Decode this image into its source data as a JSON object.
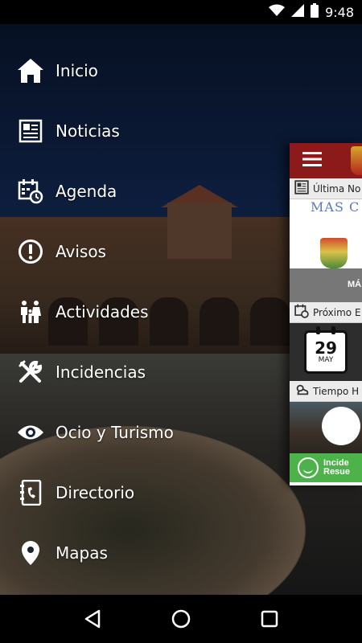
{
  "status_bar": {
    "time": "9:48",
    "icons": [
      "wifi-icon",
      "signal-icon",
      "battery-icon"
    ]
  },
  "menu": {
    "items": [
      {
        "label": "Inicio",
        "icon": "home-icon"
      },
      {
        "label": "Noticias",
        "icon": "newspaper-icon"
      },
      {
        "label": "Agenda",
        "icon": "calendar-clock-icon"
      },
      {
        "label": "Avisos",
        "icon": "alert-circle-icon"
      },
      {
        "label": "Actividades",
        "icon": "family-icon"
      },
      {
        "label": "Incidencias",
        "icon": "tools-icon"
      },
      {
        "label": "Ocio y Turismo",
        "icon": "eye-icon"
      },
      {
        "label": "Directorio",
        "icon": "contact-book-icon"
      },
      {
        "label": "Mapas",
        "icon": "map-pin-icon"
      }
    ]
  },
  "preview": {
    "news_header": "Última No",
    "news_masthead": "MAS C",
    "news_caption": "MÁ",
    "event_header": "Próximo E",
    "event_day": "29",
    "event_month": "MAY",
    "weather_header": "Tiempo H",
    "incident_line1": "Incide",
    "incident_line2": "Resue"
  },
  "colors": {
    "accent_red": "#8d1a1b",
    "accent_green": "#4db24a"
  },
  "nav_bar": {
    "buttons": [
      "back-icon",
      "home-circle-icon",
      "recents-icon"
    ]
  }
}
